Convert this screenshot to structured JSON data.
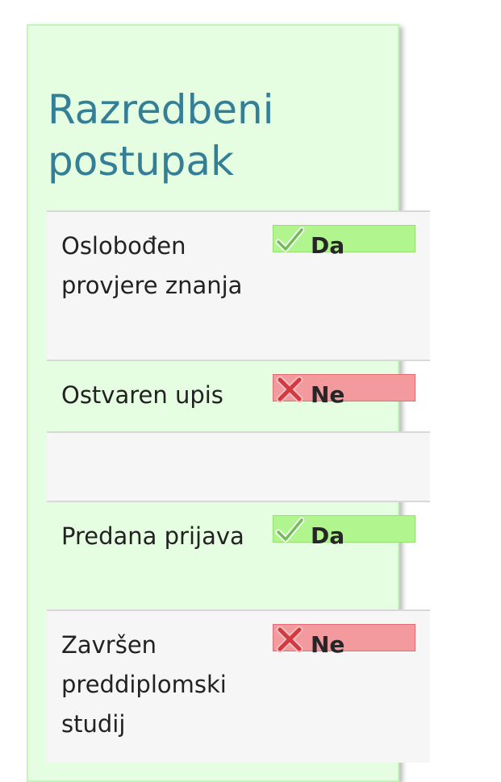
{
  "title": "Razredbeni postupak",
  "rows": [
    {
      "label": "Oslobođen provjere znanja",
      "status": "Da",
      "state": "yes",
      "icon": "checkmark-icon"
    },
    {
      "label": "Ostvaren upis",
      "status": "Ne",
      "state": "no",
      "icon": "cross-icon"
    },
    {
      "label": "",
      "status": "",
      "state": "empty",
      "icon": ""
    },
    {
      "label": "Predana prijava",
      "status": "Da",
      "state": "yes",
      "icon": "checkmark-icon"
    },
    {
      "label": "Završen preddiplomski studij",
      "status": "Ne",
      "state": "no",
      "icon": "cross-icon"
    }
  ],
  "colors": {
    "panel_bg": "#e5fde0",
    "title": "#357f96",
    "yes_badge": "#b0f58e",
    "no_badge": "#f29a9e"
  }
}
